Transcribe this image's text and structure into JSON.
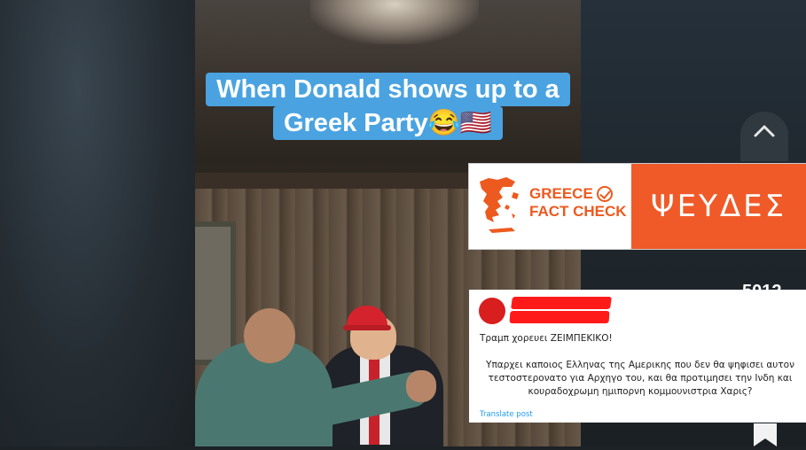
{
  "video": {
    "caption_line1": "When Donald shows up to a",
    "caption_line2": "Greek Party😂🇺🇸"
  },
  "sidebar": {
    "up_icon": "chevron-up-icon",
    "like_count": "5012",
    "bookmark_icon": "bookmark-icon"
  },
  "fact_check": {
    "brand_line1": "GREECE",
    "brand_line2": "FACT CHECK",
    "verdict": "ΨΕΥΔΕΣ",
    "brand_color": "#ec5a1f",
    "verdict_bg": "#f05a28"
  },
  "tweet": {
    "line1": "Τραμπ χορευει ΖΕΙΜΠΕΚΙΚΟ!",
    "body": "Υπαρχει καποιος Ελληνας της Αμερικης που δεν θα ψηφισει αυτον τεστοστερονατο για Αρχηγο του, και θα προτιμησει την Ινδη και κουραδοχρωμη ημιπορνη κομμουνιστρια Χαρις?",
    "translate_label": "Translate post",
    "link_color": "#1d9bf0"
  }
}
